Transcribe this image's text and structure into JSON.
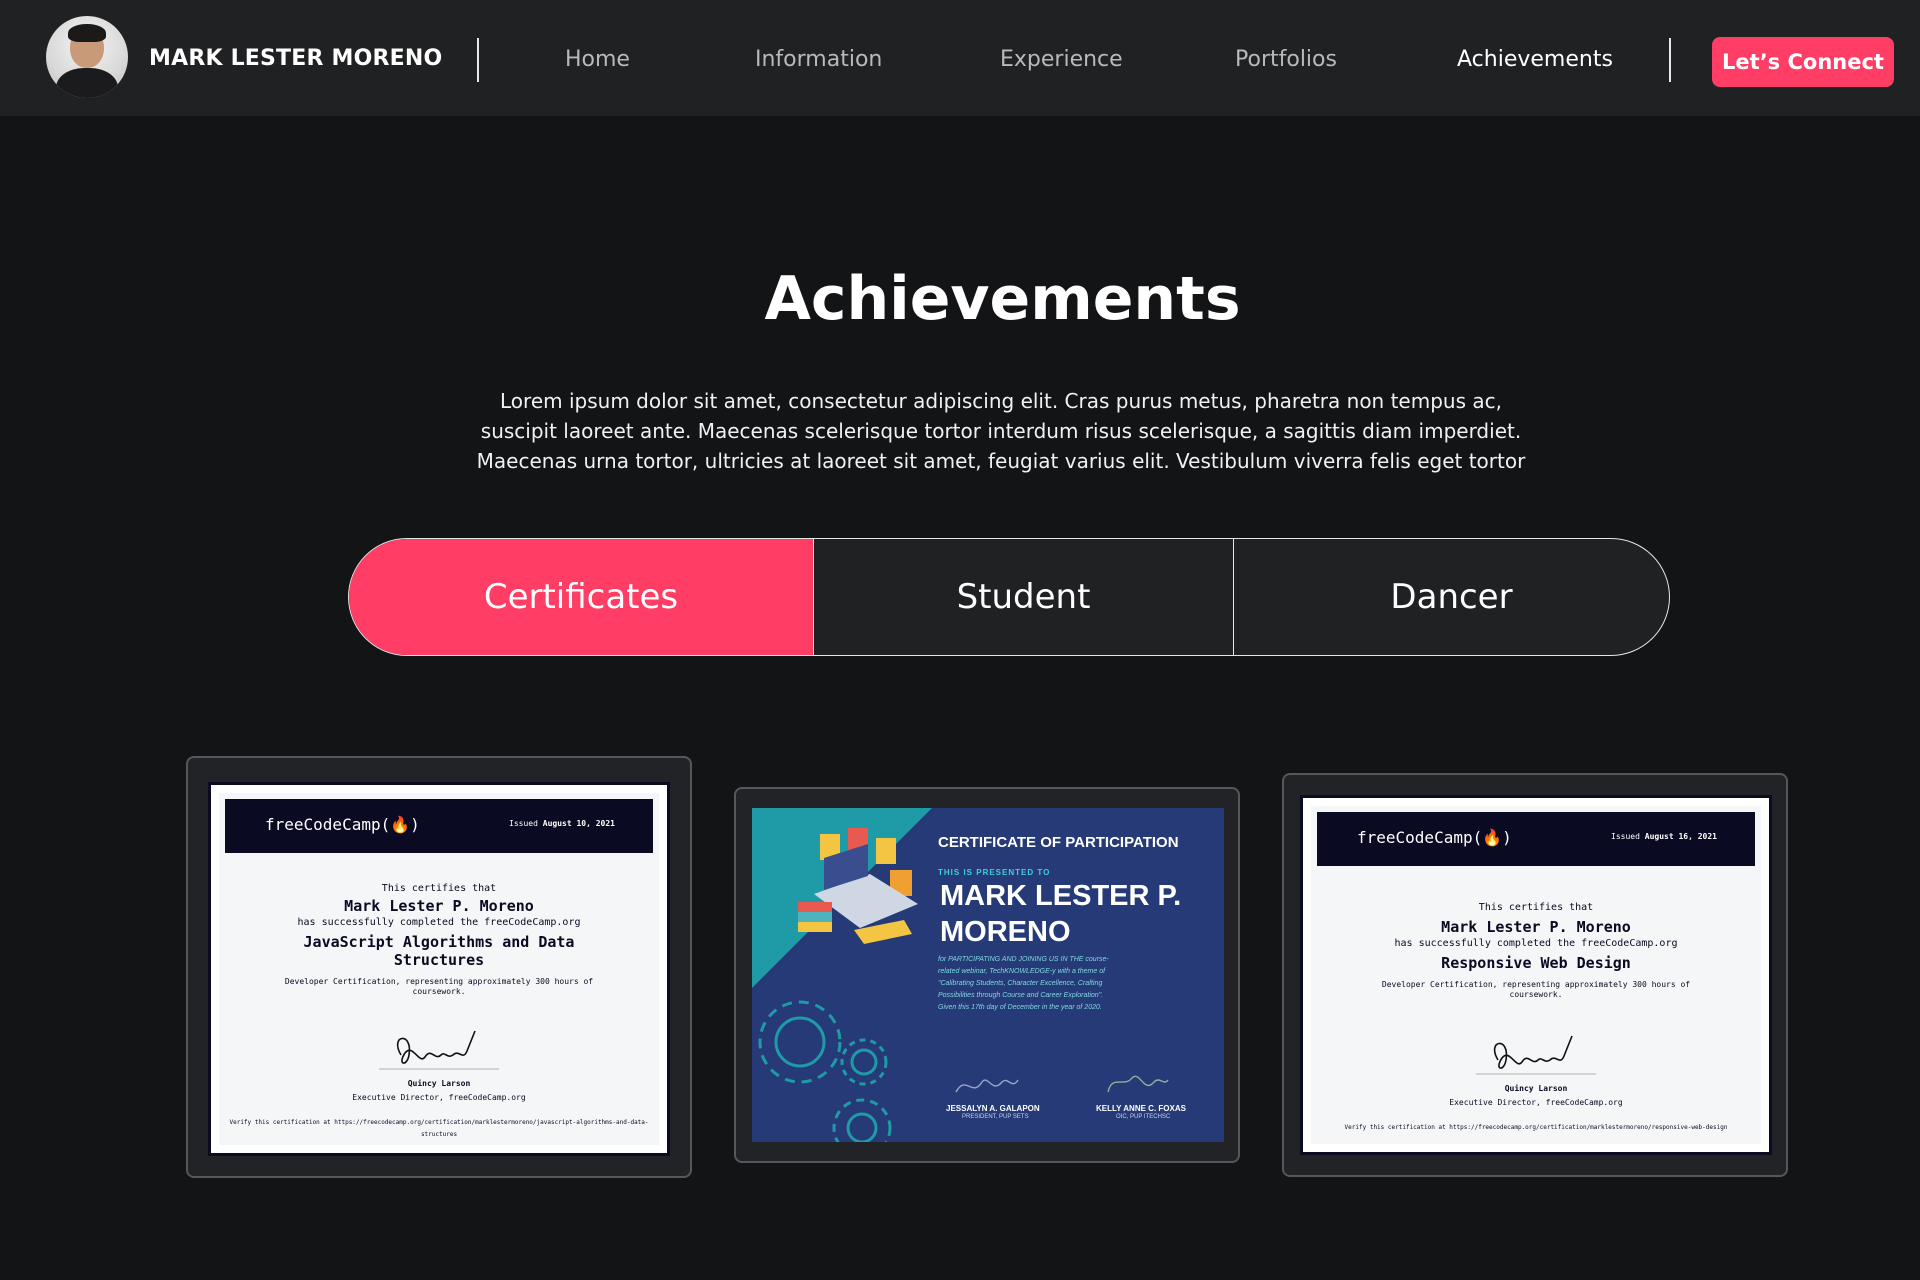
{
  "header": {
    "name": "MARK LESTER MORENO",
    "nav": [
      "Home",
      "Information",
      "Experience",
      "Portfolios",
      "Achievements"
    ],
    "active_nav": "Achievements",
    "cta_label": "Let’s Connect",
    "accent_color": "#ff3d65"
  },
  "hero": {
    "title": "Achievements",
    "description_lines": [
      "Lorem ipsum dolor sit amet, consectetur adipiscing elit. Cras purus metus, pharetra non tempus ac,",
      "suscipit laoreet ante. Maecenas scelerisque tortor interdum risus scelerisque, a sagittis diam imperdiet.",
      "Maecenas urna tortor, ultricies at laoreet sit amet, feugiat varius elit. Vestibulum viverra felis eget tortor"
    ]
  },
  "tabs": [
    "Certificates",
    "Student",
    "Dancer"
  ],
  "active_tab": "Certificates",
  "certificates": [
    {
      "logo": "freeCodeCamp(🔥)",
      "issued_prefix": "Issued",
      "issued_date": "August 10, 2021",
      "certifies": "This certifies that",
      "recipient": "Mark Lester P. Moreno",
      "completed": "has successfully completed the freeCodeCamp.org",
      "course_line1": "JavaScript Algorithms and Data",
      "course_line2": "Structures",
      "hours": "Developer Certification, representing approximately 300 hours of",
      "hours2": "coursework.",
      "signer": "Quincy Larson",
      "signer_title": "Executive Director, freeCodeCamp.org",
      "verify": "Verify this certification at https://freecodecamp.org/certification/marklestermoreno/javascript-algorithms-and-data-",
      "verify2": "structures"
    },
    {
      "heading": "CERTIFICATE OF PARTICIPATION",
      "presented": "THIS IS PRESENTED TO",
      "recipient_line1": "MARK LESTER P.",
      "recipient_line2": "MORENO",
      "body_lines": [
        "for PARTICIPATING AND JOINING US IN THE course-",
        "related webinar, TechKNOWLEDGE-y with a theme of",
        "\"Calibrating Students, Character Excellence, Crafting",
        "Possibilities through Course and Career Exploration\".",
        "Given this 17th day of December in the year of 2020."
      ],
      "signer1": "JESSALYN A. GALAPON",
      "signer1_title": "PRESIDENT, PUP SETS",
      "signer2": "KELLY ANNE C. FOXAS",
      "signer2_title": "OIC, PUP ITECHSC"
    },
    {
      "logo": "freeCodeCamp(🔥)",
      "issued_prefix": "Issued",
      "issued_date": "August 16, 2021",
      "certifies": "This certifies that",
      "recipient": "Mark Lester P. Moreno",
      "completed": "has successfully completed the freeCodeCamp.org",
      "course_line1": "Responsive Web Design",
      "hours": "Developer Certification, representing approximately 300 hours of",
      "hours2": "coursework.",
      "signer": "Quincy Larson",
      "signer_title": "Executive Director, freeCodeCamp.org",
      "verify": "Verify this certification at https://freecodecamp.org/certification/marklestermoreno/responsive-web-design"
    }
  ]
}
